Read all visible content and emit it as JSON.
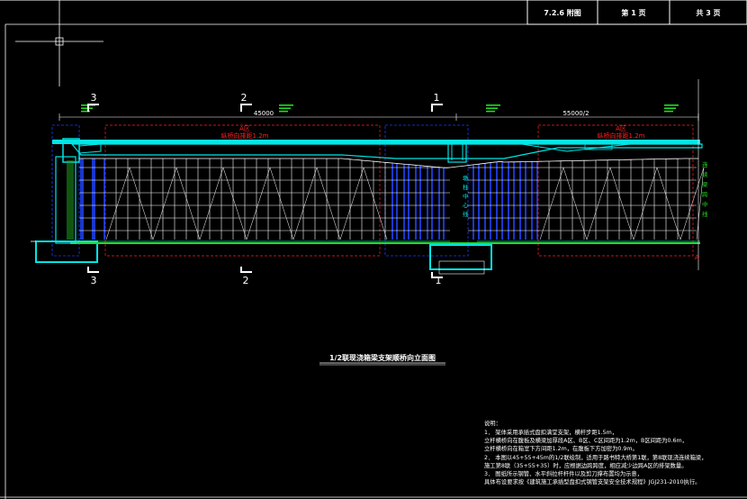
{
  "title_block": {
    "cells": [
      "7.2.6 附图",
      "第 1 页",
      "共 3 页"
    ]
  },
  "section_marks": {
    "top": [
      "3",
      "2",
      "1"
    ],
    "bottom": [
      "3",
      "2",
      "1"
    ]
  },
  "dimensions": {
    "left_span": "45000",
    "right_span": "55000/2"
  },
  "zone_labels": {
    "left_zone": "A区",
    "left_spacing": "纵桥向排距1.2m",
    "right_zone": "A区",
    "right_spacing": "纵桥向排距1.2m"
  },
  "vertical_labels": {
    "pier_center": "墩柱中心线",
    "right_text": "连续梁跨中线"
  },
  "drawing_title": "1/2联现浇箱梁支架顺桥向立面图",
  "notes": {
    "heading": "说明：",
    "lines": [
      "1．  架体采用承插式盘扣满堂支架，横杆步距1.5m，",
      "     立杆横桥向在腹板及横梁加厚段A区、B区、C区间距为1.2m，B区间距为0.6m，",
      "     立杆横桥向在箱室下方间距1.2m，在腹板下方加密为0.9m。",
      "2．  本图以45+55+45m的1/2联绘制，适用于路书特大桥第1联，第8联现浇连续箱梁，",
      "     施工第8联（35+55+35）时，应根据边跨跨度，相应减少边跨A区的排架数量。",
      "3．  图纸所示钢管、水平斜拉杆杆件以及剪刀撑布置均为示意，",
      "     具体布设要求按《建筑施工承插型盘扣式钢管支架安全技术规程》JGJ231-2010执行。"
    ]
  },
  "colors": {
    "background": "#000000",
    "frame": "#ffffff",
    "girder": "#00e5e5",
    "scaffold": "#ffffff",
    "dense_zone": "#2244ff",
    "foundation": "#22dd22",
    "zone_box": "#ff2020",
    "outline": "#1a3cff"
  }
}
